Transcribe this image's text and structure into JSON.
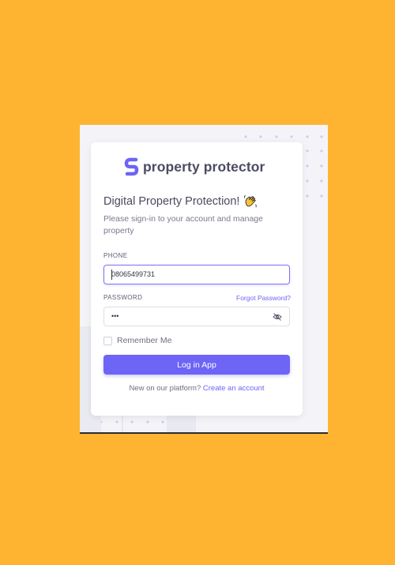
{
  "brand": {
    "name": "property protector",
    "icon": "brand-s-logo-icon",
    "color": "#6E64F5"
  },
  "heading": {
    "title": "Digital Property Protection!",
    "emoji": "waving-hand-icon",
    "subtitle": "Please sign-in to your account and manage property"
  },
  "form": {
    "phone_label": "PHONE",
    "phone_value": "08065499731",
    "password_label": "PASSWORD",
    "forgot_password": "Forgot Password?",
    "password_value": "•••",
    "password_toggle_icon": "eye-off-icon",
    "remember_label": "Remember Me",
    "remember_checked": false,
    "login_label": "Log in App"
  },
  "signup": {
    "prompt": "New on our platform?",
    "link": "Create an account"
  },
  "colors": {
    "background": "#FFB431",
    "accent": "#6E64F5",
    "panel": "#F4F4F8"
  }
}
